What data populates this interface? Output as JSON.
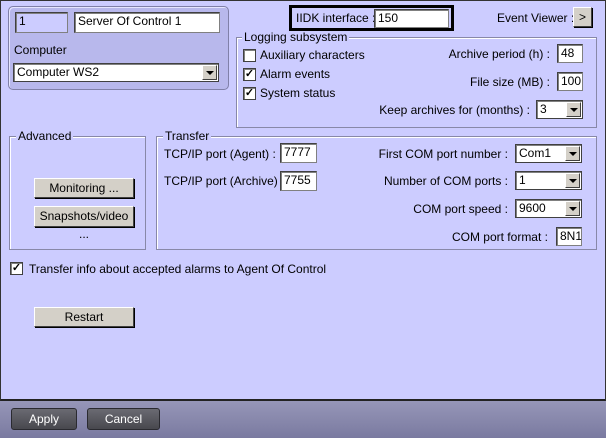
{
  "server": {
    "id": "1",
    "name": "Server Of Control 1",
    "computer_label": "Computer",
    "computer_value": "Computer WS2"
  },
  "iidk": {
    "label": "IIDK interface :",
    "value": "150"
  },
  "event_viewer": {
    "label": "Event Viewer :",
    "button": ">"
  },
  "logging": {
    "legend": "Logging subsystem",
    "checks": [
      {
        "label": "Auxiliary characters",
        "checked": false
      },
      {
        "label": "Alarm events",
        "checked": true
      },
      {
        "label": "System status",
        "checked": true
      }
    ],
    "archive_period_label": "Archive period (h) :",
    "archive_period": "48",
    "file_size_label": "File size (MB) :",
    "file_size": "100",
    "keep_label": "Keep archives for (months) :",
    "keep": "3"
  },
  "advanced": {
    "legend": "Advanced",
    "monitoring": "Monitoring ...",
    "snapshots": "Snapshots/video ..."
  },
  "transfer": {
    "legend": "Transfer",
    "agent_label": "TCP/IP port (Agent) :",
    "agent": "7777",
    "archive_label": "TCP/IP port (Archive) :",
    "archive": "7755",
    "first_com_label": "First COM port number :",
    "first_com": "Com1",
    "num_com_label": "Number of COM ports :",
    "num_com": "1",
    "speed_label": "COM port speed :",
    "speed": "9600",
    "format_label": "COM port format :",
    "format": "8N1"
  },
  "transfer_info": {
    "label": "Transfer info about accepted alarms to Agent Of Control",
    "checked": true
  },
  "restart": "Restart",
  "footer": {
    "apply": "Apply",
    "cancel": "Cancel"
  }
}
